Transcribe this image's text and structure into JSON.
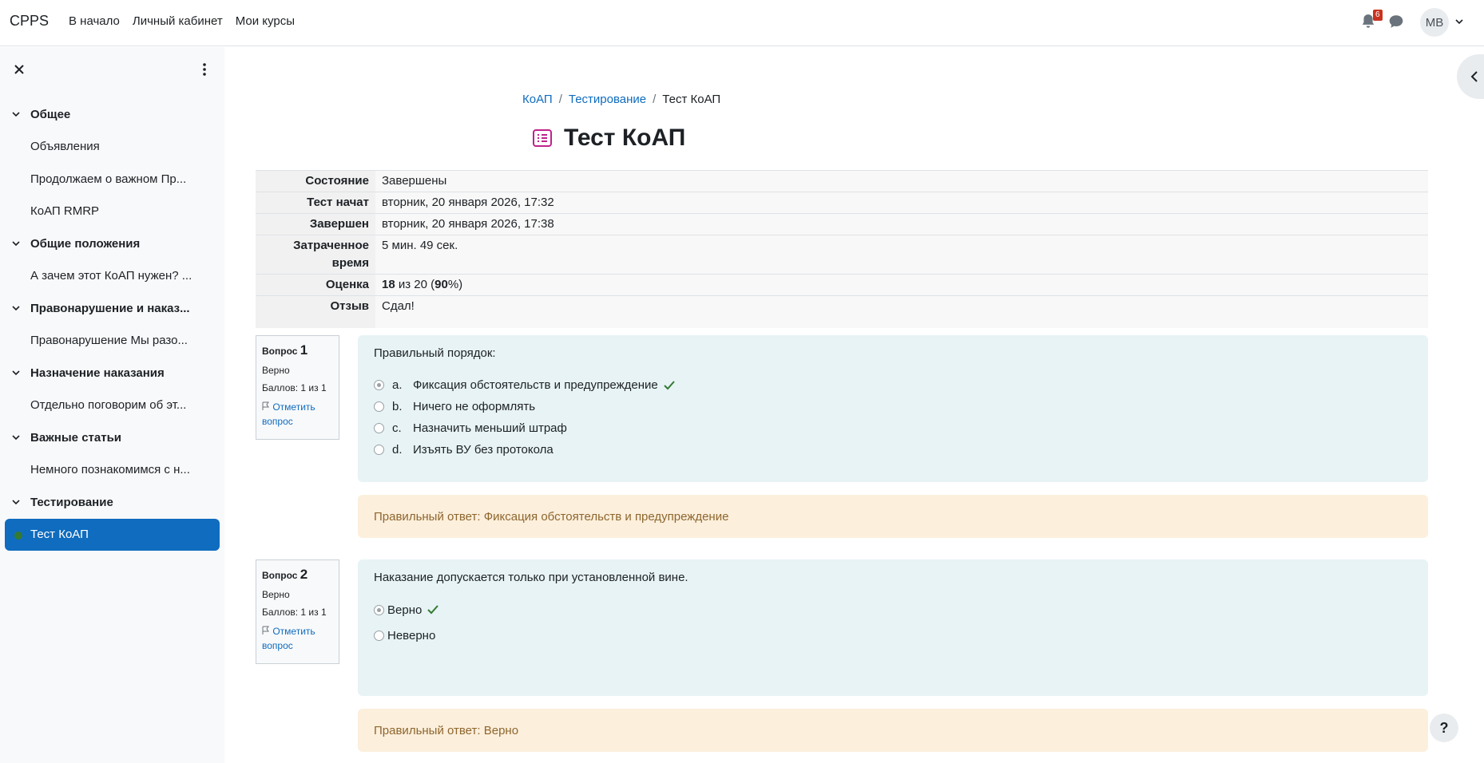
{
  "navbar": {
    "brand": "CPPS",
    "links": [
      "В начало",
      "Личный кабинет",
      "Мои курсы"
    ],
    "notification_count": "6",
    "user_initials": "MB"
  },
  "sidebar": {
    "entries": [
      {
        "type": "section",
        "label": "Общее"
      },
      {
        "type": "item",
        "label": "Объявления"
      },
      {
        "type": "item",
        "label": "Продолжаем о важном Пр..."
      },
      {
        "type": "item",
        "label": "КоАП RMRP"
      },
      {
        "type": "section",
        "label": "Общие положения"
      },
      {
        "type": "item",
        "label": "А зачем этот КоАП нужен? ..."
      },
      {
        "type": "section",
        "label": "Правонарушение и наказ..."
      },
      {
        "type": "item",
        "label": "Правонарушение Мы разо..."
      },
      {
        "type": "section",
        "label": "Назначение наказания"
      },
      {
        "type": "item",
        "label": "Отдельно поговорим об эт..."
      },
      {
        "type": "section",
        "label": "Важные статьи"
      },
      {
        "type": "item",
        "label": "Немного познакомимся с н..."
      },
      {
        "type": "section",
        "label": "Тестирование"
      },
      {
        "type": "active",
        "label": "Тест КоАП"
      }
    ]
  },
  "breadcrumb": {
    "items": [
      "КоАП",
      "Тестирование",
      "Тест КоАП"
    ]
  },
  "page_title": "Тест КоАП",
  "summary": [
    {
      "label": "Состояние",
      "value": "Завершены"
    },
    {
      "label": "Тест начат",
      "value": "вторник, 20 января 2026, 17:32"
    },
    {
      "label": "Завершен",
      "value": "вторник, 20 января 2026, 17:38"
    },
    {
      "label": "Затраченное время",
      "value": "5 мин. 49 сек."
    },
    {
      "label": "Оценка",
      "value_grade": "18",
      "value_mid": " из 20 (",
      "value_pct": "90",
      "value_end": "%)"
    },
    {
      "label": "Отзыв",
      "value": "Сдал!"
    }
  ],
  "questions": [
    {
      "prefix": "Вопрос",
      "number": "1",
      "state": "Верно",
      "marks": "Баллов: 1 из 1",
      "flag": "Отметить вопрос",
      "text": "Правильный порядок:",
      "answers": [
        {
          "letter": "a.",
          "text": "Фиксация обстоятельств и предупреждение",
          "checked": true,
          "correct": true
        },
        {
          "letter": "b.",
          "text": "Ничего не оформлять"
        },
        {
          "letter": "c.",
          "text": "Назначить меньший штраф"
        },
        {
          "letter": "d.",
          "text": "Изъять ВУ без протокола"
        }
      ],
      "feedback": "Правильный ответ: Фиксация обстоятельств и предупреждение"
    },
    {
      "prefix": "Вопрос",
      "number": "2",
      "state": "Верно",
      "marks": "Баллов: 1 из 1",
      "flag": "Отметить вопрос",
      "text": "Наказание допускается только при установленной вине.",
      "answers": [
        {
          "text": "Верно",
          "checked": true,
          "correct": true
        },
        {
          "text": "Неверно"
        }
      ],
      "feedback": "Правильный ответ: Верно"
    }
  ],
  "help_label": "?",
  "colors": {
    "primary": "#0f6cbf",
    "correct": "#357a32",
    "question_bg": "#e7f3f5",
    "feedback_bg": "#fcefdc",
    "badge": "#ca3120"
  }
}
